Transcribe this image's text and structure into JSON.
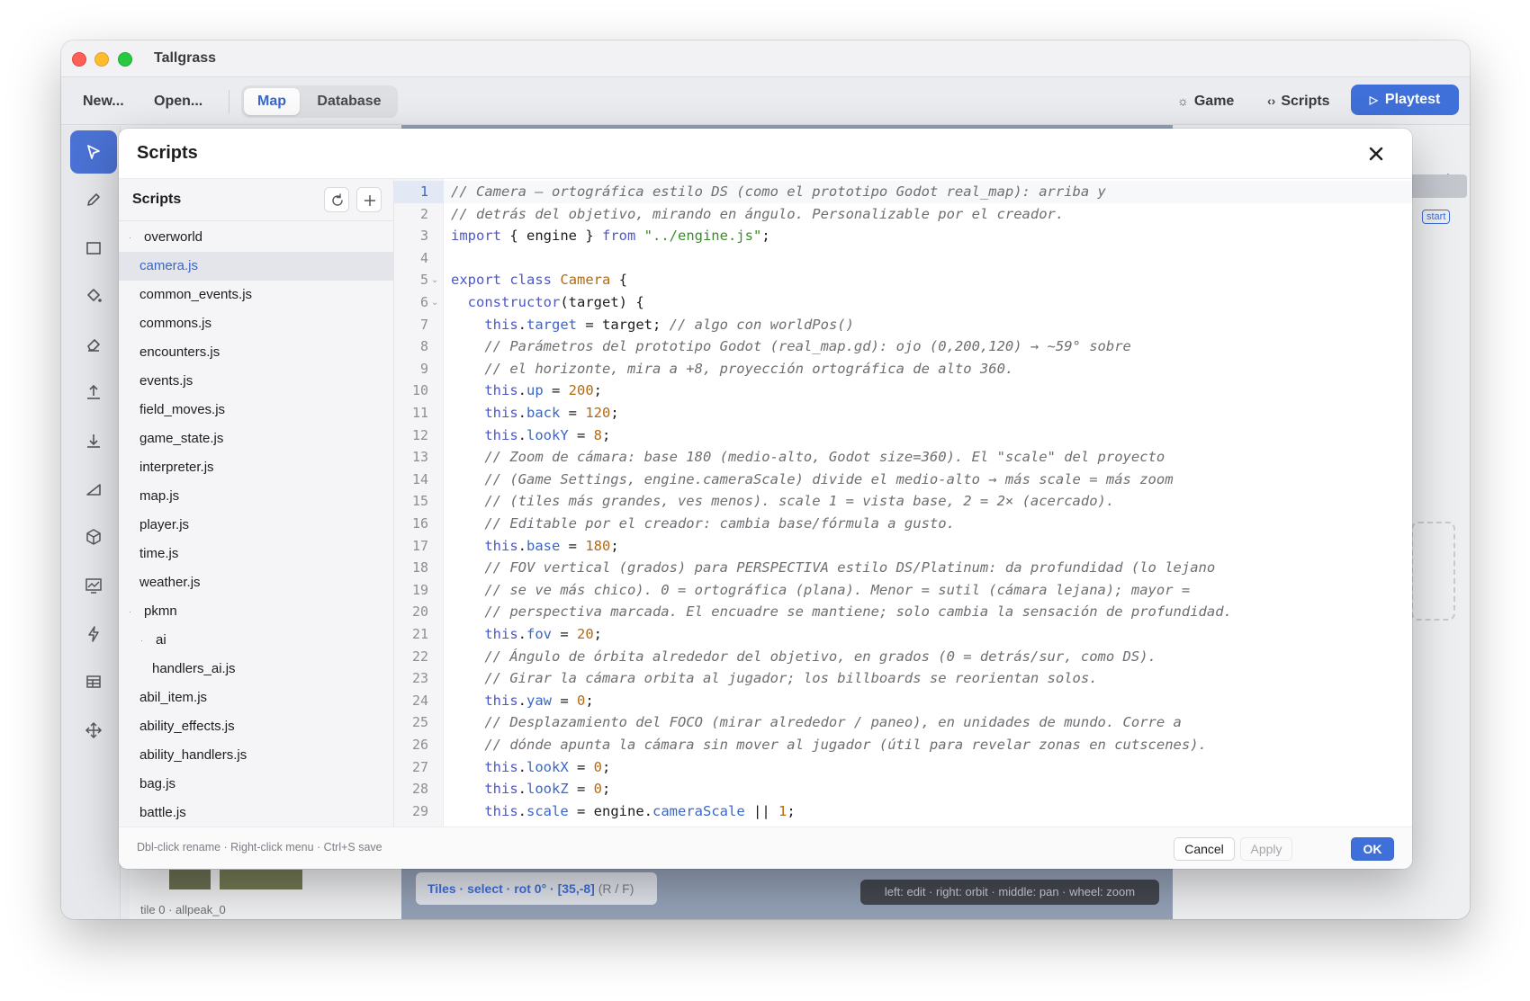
{
  "app": {
    "title": "Tallgrass"
  },
  "toolbar": {
    "new_label": "New...",
    "open_label": "Open...",
    "tabs": [
      "Map",
      "Database"
    ],
    "active_tab": "Map",
    "game_label": "Game",
    "scripts_label": "Scripts",
    "playtest_label": "Playtest"
  },
  "background": {
    "tile_label": "tile 0 · allpeak_0",
    "status": {
      "mode": "Tiles · select · rot 0° · [35,-8]",
      "keys": "(R / F)"
    },
    "hint": "left: edit · right: orbit · middle: pan · wheel: zoom",
    "badge": "start"
  },
  "modal": {
    "title": "Scripts",
    "sidebar_title": "Scripts",
    "tree": [
      {
        "label": "overworld",
        "type": "folder",
        "depth": 0
      },
      {
        "label": "camera.js",
        "type": "file",
        "depth": 1,
        "selected": true
      },
      {
        "label": "common_events.js",
        "type": "file",
        "depth": 1
      },
      {
        "label": "commons.js",
        "type": "file",
        "depth": 1
      },
      {
        "label": "encounters.js",
        "type": "file",
        "depth": 1
      },
      {
        "label": "events.js",
        "type": "file",
        "depth": 1
      },
      {
        "label": "field_moves.js",
        "type": "file",
        "depth": 1
      },
      {
        "label": "game_state.js",
        "type": "file",
        "depth": 1
      },
      {
        "label": "interpreter.js",
        "type": "file",
        "depth": 1
      },
      {
        "label": "map.js",
        "type": "file",
        "depth": 1
      },
      {
        "label": "player.js",
        "type": "file",
        "depth": 1
      },
      {
        "label": "time.js",
        "type": "file",
        "depth": 1
      },
      {
        "label": "weather.js",
        "type": "file",
        "depth": 1
      },
      {
        "label": "pkmn",
        "type": "folder",
        "depth": 0
      },
      {
        "label": "ai",
        "type": "folder",
        "depth": 1
      },
      {
        "label": "handlers_ai.js",
        "type": "file",
        "depth": 2
      },
      {
        "label": "abil_item.js",
        "type": "file",
        "depth": 1
      },
      {
        "label": "ability_effects.js",
        "type": "file",
        "depth": 1
      },
      {
        "label": "ability_handlers.js",
        "type": "file",
        "depth": 1
      },
      {
        "label": "bag.js",
        "type": "file",
        "depth": 1
      },
      {
        "label": "battle.js",
        "type": "file",
        "depth": 1
      }
    ],
    "current_line": 1,
    "code_lines": [
      "// Camera — ortográfica estilo DS (como el prototipo Godot real_map): arriba y",
      "// detrás del objetivo, mirando en ángulo. Personalizable por el creador.",
      "import { engine } from \"../engine.js\";",
      "",
      "export class Camera {",
      "  constructor(target) {",
      "    this.target = target; // algo con worldPos()",
      "    // Parámetros del prototipo Godot (real_map.gd): ojo (0,200,120) → ~59° sobre",
      "    // el horizonte, mira a +8, proyección ortográfica de alto 360.",
      "    this.up = 200;",
      "    this.back = 120;",
      "    this.lookY = 8;",
      "    // Zoom de cámara: base 180 (medio-alto, Godot size=360). El \"scale\" del proyecto",
      "    // (Game Settings, engine.cameraScale) divide el medio-alto → más scale = más zoom",
      "    // (tiles más grandes, ves menos). scale 1 = vista base, 2 = 2× (acercado).",
      "    // Editable por el creador: cambia base/fórmula a gusto.",
      "    this.base = 180;",
      "    // FOV vertical (grados) para PERSPECTIVA estilo DS/Platinum: da profundidad (lo lejano",
      "    // se ve más chico). 0 = ortográfica (plana). Menor = sutil (cámara lejana); mayor =",
      "    // perspectiva marcada. El encuadre se mantiene; solo cambia la sensación de profundidad.",
      "    this.fov = 20;",
      "    // Ángulo de órbita alrededor del objetivo, en grados (0 = detrás/sur, como DS).",
      "    // Girar la cámara orbita al jugador; los billboards se reorientan solos.",
      "    this.yaw = 0;",
      "    // Desplazamiento del FOCO (mirar alrededor / paneo), en unidades de mundo. Corre a",
      "    // dónde apunta la cámara sin mover al jugador (útil para revelar zonas en cutscenes).",
      "    this.lookX = 0;",
      "    this.lookZ = 0;",
      "    this.scale = engine.cameraScale || 1;"
    ],
    "footer_hint": "Dbl-click rename · Right-click menu · Ctrl+S save",
    "cancel_label": "Cancel",
    "apply_label": "Apply",
    "ok_label": "OK"
  },
  "tools": [
    "select-arrow-icon",
    "pencil-icon",
    "rectangle-icon",
    "fill-bucket-icon",
    "eraser-icon",
    "raise-icon",
    "lower-icon",
    "slope-icon",
    "cube-icon",
    "terrain-icon",
    "lightning-icon",
    "tileset-icon",
    "move-icon"
  ],
  "colors": {
    "accent": "#3f6fd8",
    "comment": "#6e6e73",
    "keyword": "#4d57c8",
    "number": "#b36a14",
    "string": "#3f8a2f"
  }
}
